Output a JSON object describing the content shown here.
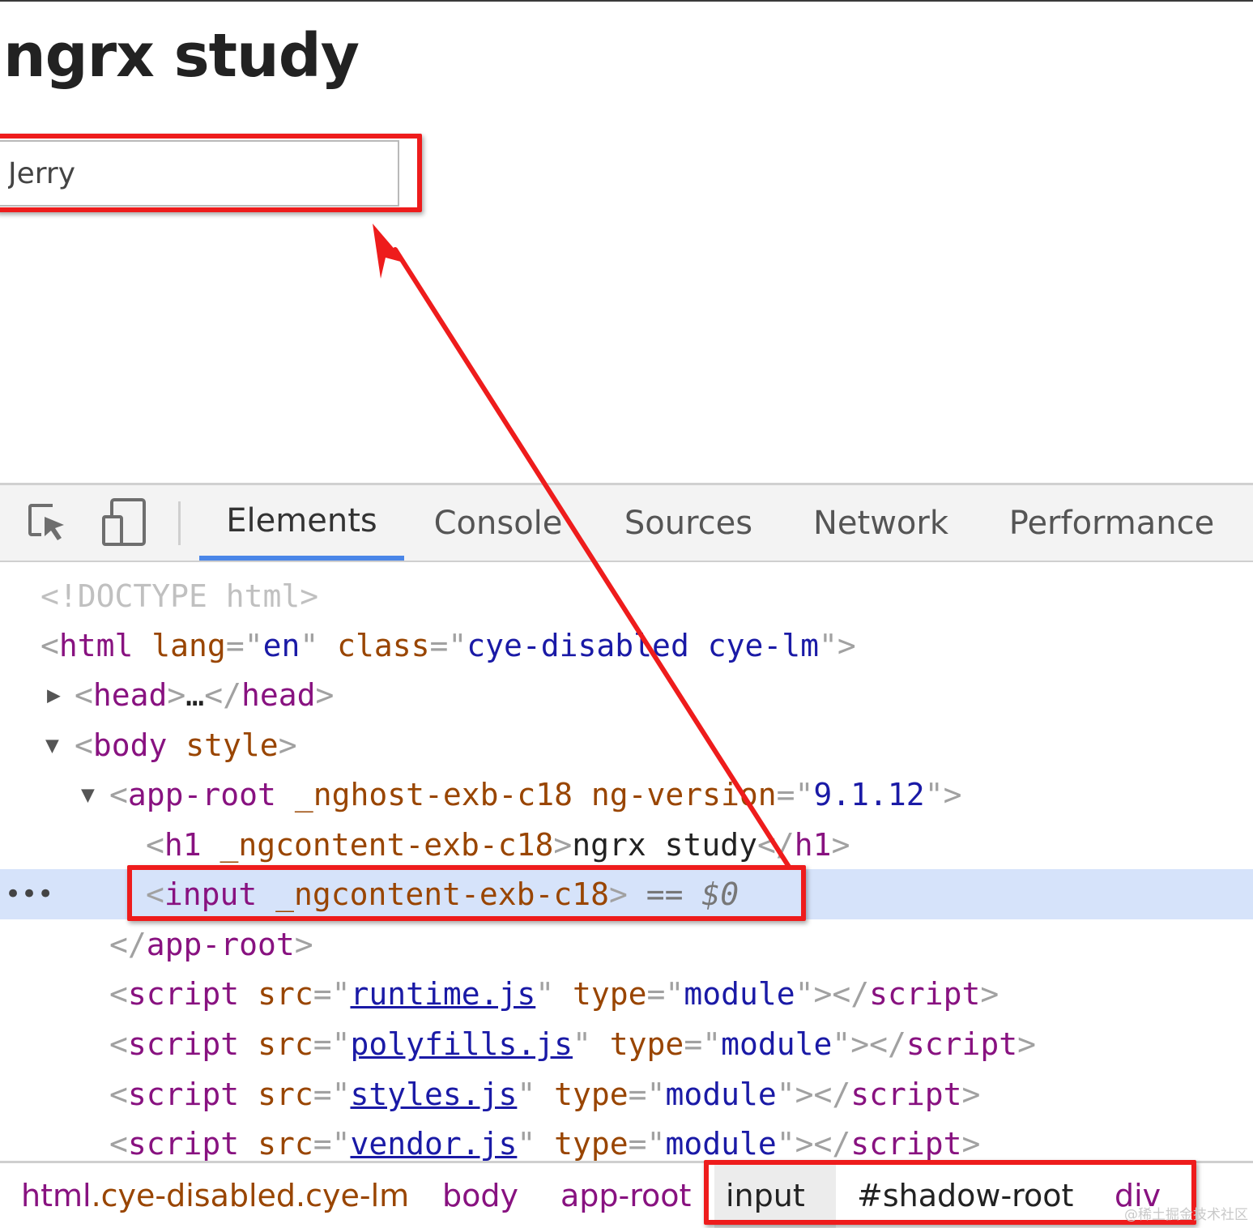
{
  "page": {
    "title": "ngrx study",
    "input_value": "Jerry"
  },
  "devtools": {
    "icons": [
      "inspect-element-icon",
      "device-toolbar-icon"
    ],
    "tabs": [
      {
        "label": "Elements",
        "active": true
      },
      {
        "label": "Console",
        "active": false
      },
      {
        "label": "Sources",
        "active": false
      },
      {
        "label": "Network",
        "active": false
      },
      {
        "label": "Performance",
        "active": false
      }
    ],
    "tree": {
      "doctype": "<!DOCTYPE html>",
      "html_tag": "html",
      "html_attr_lang": "lang",
      "html_lang_value": "en",
      "html_attr_class": "class",
      "html_class_value": "cye-disabled cye-lm",
      "head_tag": "head",
      "head_ellipsis": "…",
      "body_tag": "body",
      "body_attr": "style",
      "approot_tag": "app-root",
      "approot_attr_host": "_nghost-exb-c18",
      "approot_attr_ver": "ng-version",
      "approot_ver_value": "9.1.12",
      "h1_tag": "h1",
      "h1_attr": "_ngcontent-exb-c18",
      "h1_text": "ngrx study",
      "input_tag": "input",
      "input_attr": "_ngcontent-exb-c18",
      "selected_marker": "== $0",
      "more_dots": "•••",
      "scripts": [
        {
          "src": "runtime.js",
          "type": "module"
        },
        {
          "src": "polyfills.js",
          "type": "module"
        },
        {
          "src": "styles.js",
          "type": "module"
        },
        {
          "src": "vendor.js",
          "type": "module"
        }
      ],
      "script_tag": "script",
      "script_attr_src": "src",
      "script_attr_type": "type"
    },
    "breadcrumbs": [
      {
        "tag": "html",
        "cls": ".cye-disabled.cye-lm"
      },
      {
        "tag": "body",
        "cls": ""
      },
      {
        "tag": "app-root",
        "cls": ""
      },
      {
        "tag": "input",
        "cls": ""
      },
      {
        "tag": "#shadow-root",
        "cls": ""
      },
      {
        "tag": "div",
        "cls": ""
      }
    ]
  },
  "annotations": {
    "highlight_color": "#ee1c1c",
    "selection_color": "#d6e3fa",
    "tab_underline_color": "#4a86e8"
  },
  "watermark": "@稀土掘金技术社区"
}
